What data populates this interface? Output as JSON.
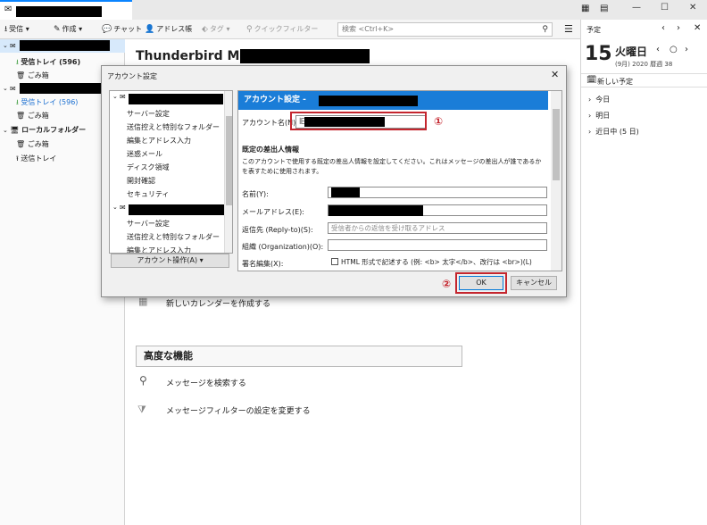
{
  "app": {
    "tab_icon": "envelope-icon",
    "window_buttons": [
      "—",
      "☐",
      "✕"
    ]
  },
  "toolbar": {
    "get_mail": "受信",
    "write": "作成",
    "chat": "チャット",
    "address_book": "アドレス帳",
    "tag": "タグ",
    "quick_filter": "クイックフィルター",
    "search_placeholder": "検索 <Ctrl+K>",
    "menu_icon": "hamburger-icon"
  },
  "folders": {
    "inbox1": "受信トレイ (596)",
    "trash1": "ごみ箱",
    "inbox2": "受信トレイ (596)",
    "trash2": "ごみ箱",
    "local": "ローカルフォルダー",
    "trash3": "ごみ箱",
    "outbox": "送信トレイ"
  },
  "main": {
    "title": "Thunderbird Mail -",
    "new_calendar": "新しいカレンダーを作成する",
    "advanced_heading": "高度な機能",
    "search_messages": "メッセージを検索する",
    "filters": "メッセージフィルターの設定を変更する"
  },
  "calendar": {
    "header": "予定",
    "day": "15",
    "weekday": "火曜日",
    "date_sub": "(9月) 2020 暦週 38",
    "new_event": "新しい予定",
    "today": "今日",
    "tomorrow": "明日",
    "upcoming": "近日中 (5 日)"
  },
  "dialog": {
    "title": "アカウント設定",
    "close": "✕",
    "tree": {
      "server": "サーバー設定",
      "copies": "送信控えと特別なフォルダー",
      "composition": "編集とアドレス入力",
      "junk": "迷惑メール",
      "disk": "ディスク領域",
      "receipts": "開封確認",
      "security": "セキュリティ",
      "server2": "サーバー設定",
      "copies2": "送信控えと特別なフォルダー",
      "composition2": "編集とアドレス入力"
    },
    "account_actions": "アカウント操作(A)",
    "header": "アカウント設定 - ",
    "account_name_label": "アカウント名(N):",
    "account_name_value": "旧",
    "circle1": "①",
    "identity_heading": "既定の差出人情報",
    "identity_desc1": "このアカウントで使用する既定の差出人情報を設定してください。これはメッセージの差出人が誰であるか",
    "identity_desc2": "を表すために使用されます。",
    "name_label": "名前(Y):",
    "email_label": "メールアドレス(E):",
    "replyto_label": "返信先 (Reply-to)(S):",
    "replyto_placeholder": "受信者からの返信を受け取るアドレス",
    "org_label": "組織 (Organization)(O):",
    "signature_label": "署名編集(X):",
    "html_checkbox": "HTML 形式で記述する (例: <b> 太字</b>、改行は <br>)(L)",
    "circle2": "②",
    "ok": "OK",
    "cancel": "キャンセル"
  }
}
